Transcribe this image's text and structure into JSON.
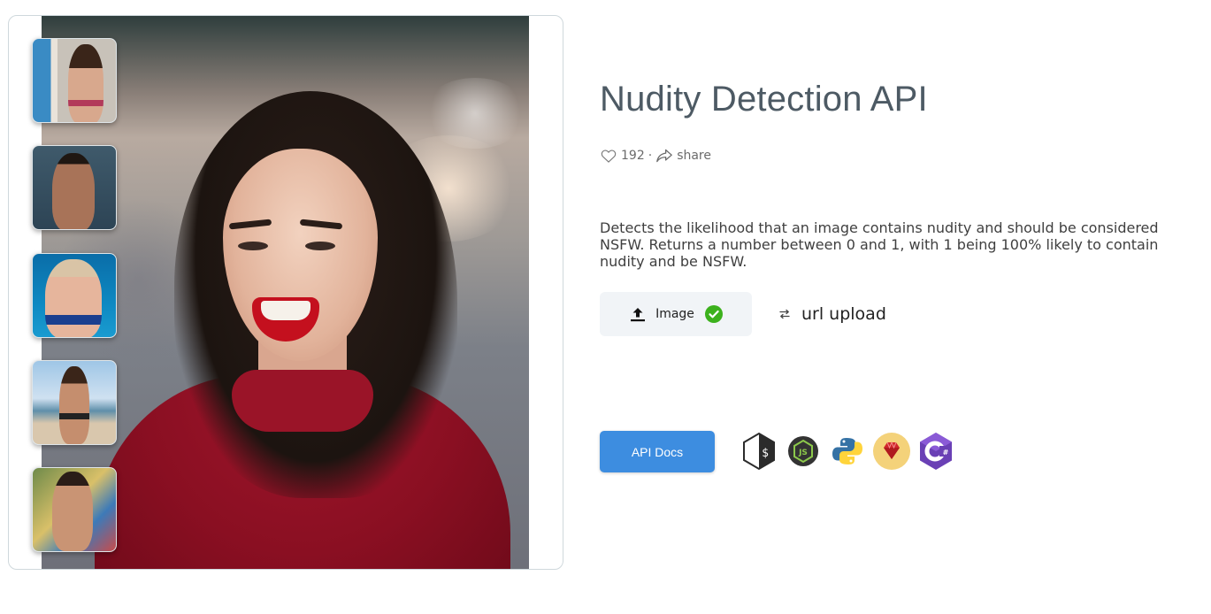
{
  "title": "Nudity Detection API",
  "meta": {
    "likes": "192",
    "separator": "·",
    "share_label": "share"
  },
  "description": "Detects the likelihood that an image contains nudity and should be considered NSFW. Returns a number between 0 and 1, with 1 being 100% likely to contain nudity and be NSFW.",
  "input": {
    "image_label": "Image",
    "image_status": "selected",
    "url_upload_label": "url upload"
  },
  "api_docs_label": "API Docs",
  "languages": [
    "bash",
    "nodejs",
    "python",
    "ruby",
    "csharp"
  ],
  "colors": {
    "primary_button": "#3d8de0",
    "success": "#3cb11d",
    "title": "#4d5a64"
  }
}
